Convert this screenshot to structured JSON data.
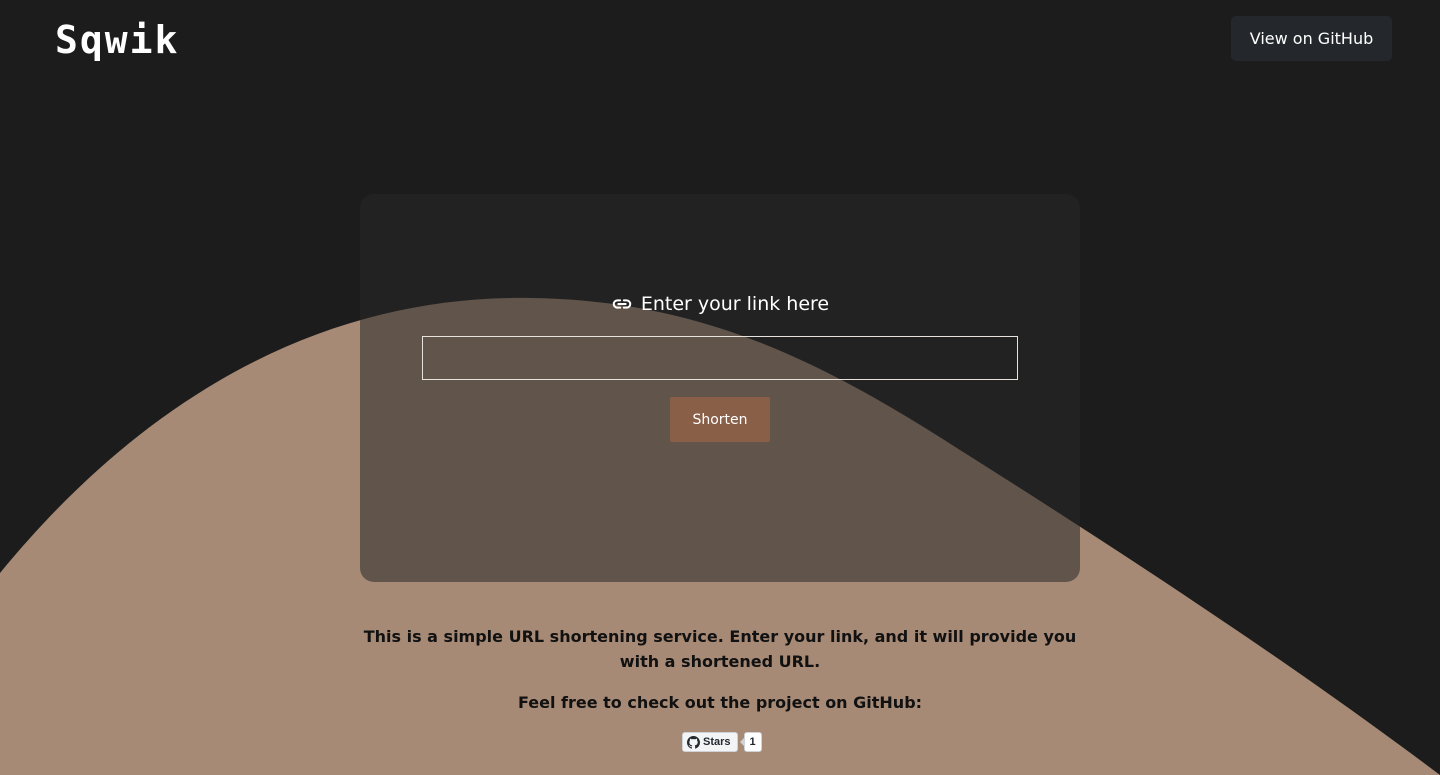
{
  "header": {
    "logo_text": "Sqwik",
    "github_button_label": "View on GitHub"
  },
  "form": {
    "label": "Enter your link here",
    "input_value": "",
    "input_placeholder": "",
    "submit_label": "Shorten"
  },
  "info": {
    "description": "This is a simple URL shortening service. Enter your link, and it will provide you with a shortened URL.",
    "github_prompt": "Feel free to check out the project on GitHub:"
  },
  "github_badge": {
    "label": "Stars",
    "count": "1"
  },
  "colors": {
    "background": "#1c1c1c",
    "wave": "#a68a76",
    "accent_button": "#8a5f48",
    "header_button": "#24282c"
  },
  "icons": {
    "link": "link-icon",
    "github": "github-icon"
  }
}
